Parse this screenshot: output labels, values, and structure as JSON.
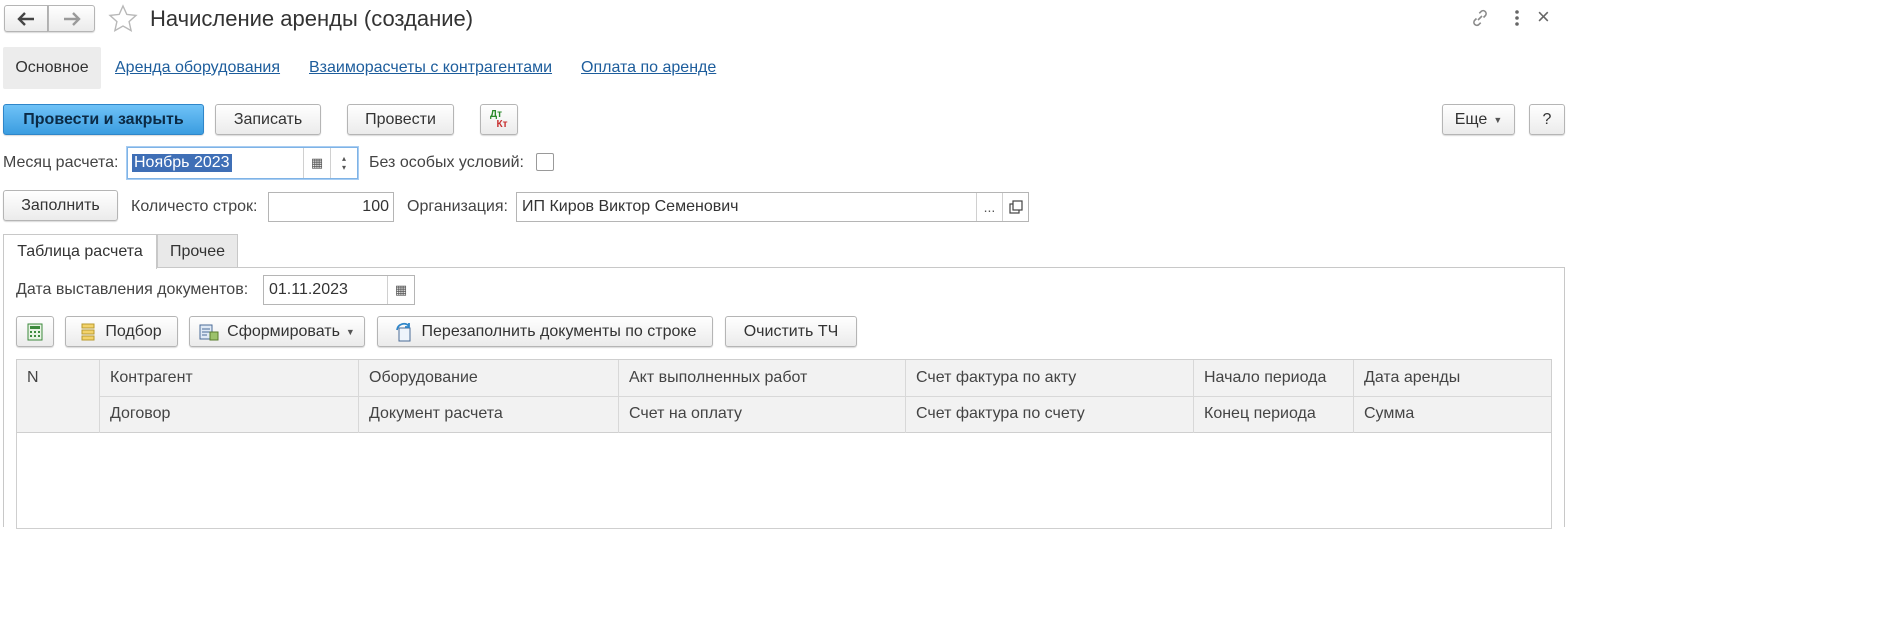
{
  "window": {
    "title": "Начисление аренды (создание)",
    "back_icon": "arrow-left-icon",
    "forward_icon": "arrow-right-icon",
    "favorite_icon": "star-icon",
    "link_icon": "link-icon",
    "more_icon": "kebab-icon",
    "close_label": "×"
  },
  "nav": {
    "active": "Основное",
    "links": [
      "Аренда оборудования",
      "Взаиморасчеты с контрагентами",
      "Оплата по аренде"
    ]
  },
  "toolbar": {
    "post_close": "Провести и закрыть",
    "save": "Записать",
    "post": "Провести",
    "dtkt_top": "Дт",
    "dtkt_bottom": "Кт",
    "more": "Еще",
    "help": "?"
  },
  "form": {
    "month_label": "Месяц расчета:",
    "month_value": "Ноябрь 2023",
    "no_special_label": "Без особых условий:",
    "no_special_checked": false,
    "fill_button": "Заполнить",
    "rows_label": "Количесто строк:",
    "rows_value": "100",
    "org_label": "Организация:",
    "org_value": "ИП Киров Виктор Семенович",
    "org_select": "..."
  },
  "tabs": [
    "Таблица расчета",
    "Прочее"
  ],
  "calc": {
    "doc_date_label": "Дата выставления документов:",
    "doc_date_value": "01.11.2023",
    "buttons": {
      "pick": "Подбор",
      "generate": "Сформировать",
      "refill": "Перезаполнить документы по строке",
      "clear": "Очистить ТЧ"
    }
  },
  "grid": {
    "col_n": "N",
    "row1": [
      "Контрагент",
      "Оборудование",
      "Акт выполненных работ",
      "Счет фактура по акту",
      "Начало периода",
      "Дата аренды"
    ],
    "row2": [
      "Договор",
      "Документ расчета",
      "Счет на оплату",
      "Счет фактура по счету",
      "Конец периода",
      "Сумма"
    ]
  },
  "colors": {
    "accent": "#3b9de0",
    "link": "#1d5d9c",
    "selection": "#3f6fb6"
  }
}
